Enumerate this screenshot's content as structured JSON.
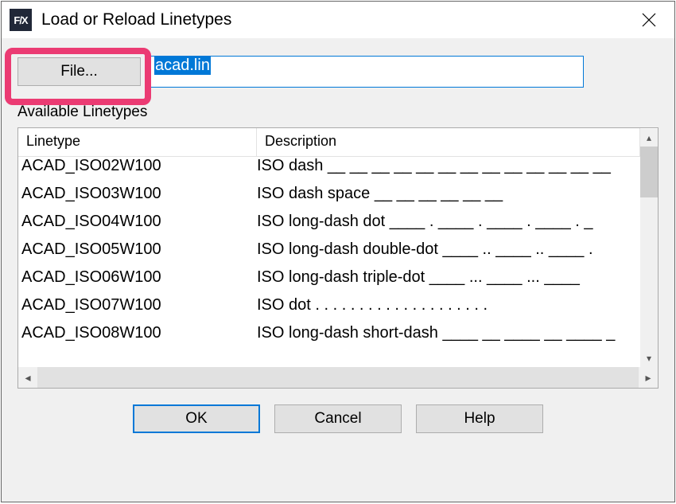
{
  "window": {
    "app_icon_text": "F/X",
    "title": "Load or Reload Linetypes"
  },
  "file": {
    "button_label": "File...",
    "value": "acad.lin"
  },
  "section_label": "Available Linetypes",
  "columns": {
    "linetype": "Linetype",
    "description": "Description"
  },
  "rows": [
    {
      "linetype": "ACAD_ISO02W100",
      "description": "ISO dash __ __ __ __ __ __ __ __ __ __ __ __ __"
    },
    {
      "linetype": "ACAD_ISO03W100",
      "description": "ISO dash space __    __    __    __    __    __"
    },
    {
      "linetype": "ACAD_ISO04W100",
      "description": "ISO long-dash dot ____ . ____ . ____ . ____ . _"
    },
    {
      "linetype": "ACAD_ISO05W100",
      "description": "ISO long-dash double-dot ____ .. ____ .. ____ ."
    },
    {
      "linetype": "ACAD_ISO06W100",
      "description": "ISO long-dash triple-dot ____ ... ____ ... ____"
    },
    {
      "linetype": "ACAD_ISO07W100",
      "description": "ISO dot . . . . . . . . . . . . . . . . . . . ."
    },
    {
      "linetype": "ACAD_ISO08W100",
      "description": "ISO long-dash short-dash ____ __ ____ __ ____ _"
    }
  ],
  "buttons": {
    "ok": "OK",
    "cancel": "Cancel",
    "help": "Help"
  }
}
